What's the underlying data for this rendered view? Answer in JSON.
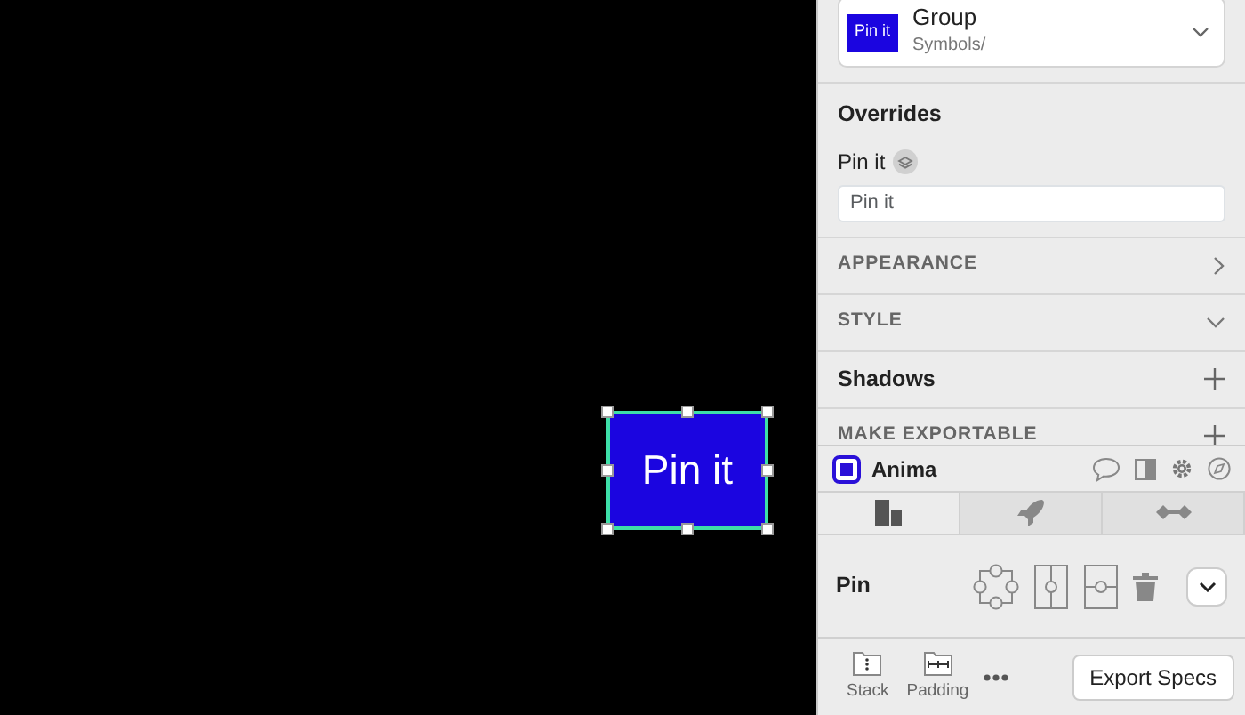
{
  "canvas": {
    "element": {
      "label": "Pin it",
      "selected": true
    }
  },
  "inspector": {
    "symbol": {
      "preview": "Pin it",
      "name": "Group",
      "path": "Symbols/"
    },
    "overrides": {
      "title": "Overrides",
      "label": "Pin it",
      "placeholder": "Pin it"
    },
    "sections": [
      {
        "title": "APPEARANCE",
        "kind": "category",
        "expanded": false
      },
      {
        "title": "STYLE",
        "kind": "category",
        "expanded": true
      },
      {
        "title": "Shadows",
        "kind": "option"
      },
      {
        "title": "MAKE EXPORTABLE",
        "kind": "export"
      }
    ]
  },
  "plugin": {
    "name": "Anima",
    "tabs": [
      {
        "selected": true
      },
      {
        "selected": false
      },
      {
        "selected": false
      }
    ],
    "pin": {
      "label": "Pin"
    },
    "toolbar": [
      {
        "label": "Stack"
      },
      {
        "label": "Padding"
      }
    ],
    "export_button": "Export Specs"
  }
}
